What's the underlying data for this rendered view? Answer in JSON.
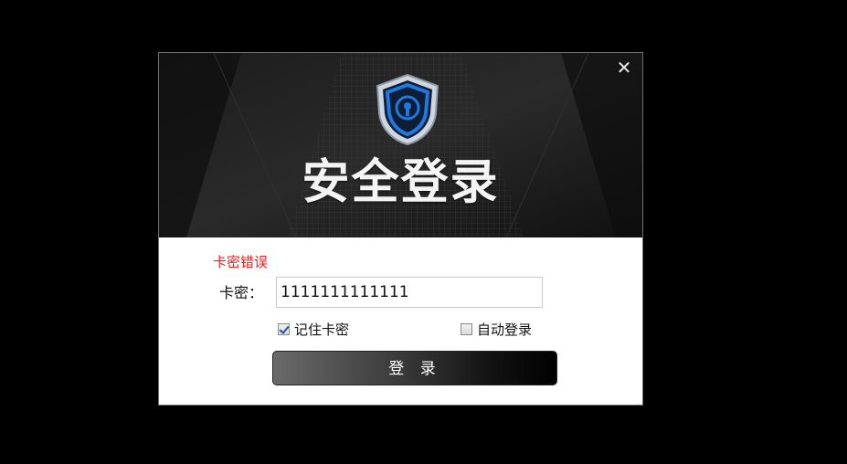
{
  "dialog": {
    "banner_title": "安全登录",
    "close_symbol": "✕",
    "error_message": "卡密错误",
    "field_label": "卡密：",
    "field_value": "1111111111111",
    "remember_label": "记住卡密",
    "remember_checked": true,
    "auto_login_label": "自动登录",
    "auto_login_checked": false,
    "login_button": "登 录"
  },
  "colors": {
    "error": "#ff1a1a",
    "shield_blue": "#1e78e6",
    "banner_bg": "#161616"
  },
  "icons": {
    "close": "close-icon",
    "shield": "shield-lock-icon"
  }
}
